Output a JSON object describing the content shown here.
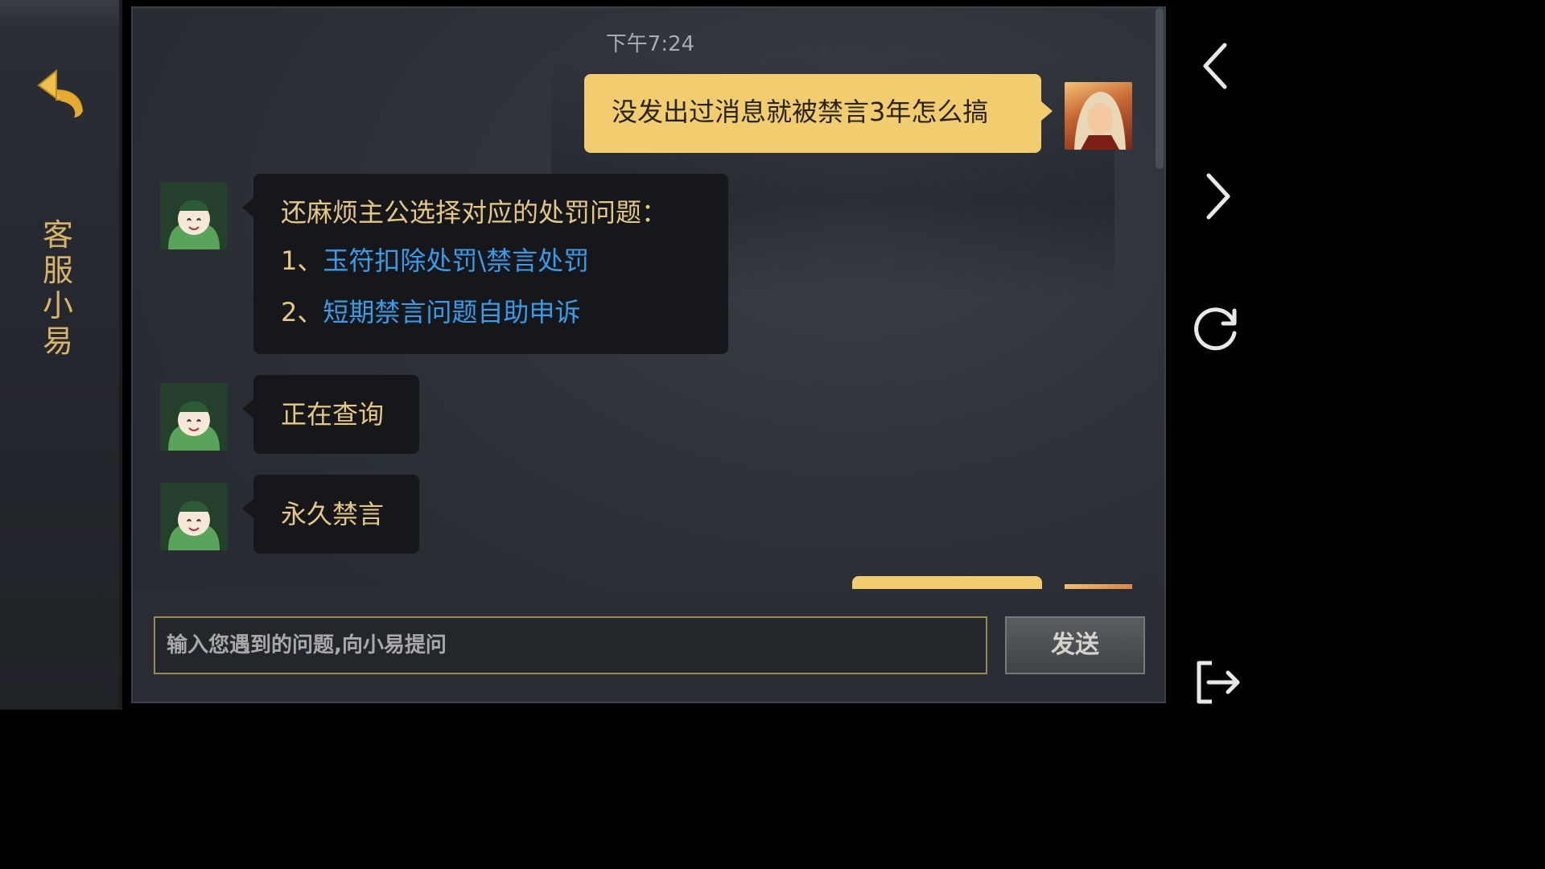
{
  "sidebar": {
    "title": "客服小易",
    "back_icon": "back-arrow-icon"
  },
  "chat": {
    "timestamp": "下午7:24",
    "messages": [
      {
        "from": "user",
        "text": "没发出过消息就被禁言3年怎么搞"
      },
      {
        "from": "bot",
        "intro": "还麻烦主公选择对应的处罚问题：",
        "options": [
          {
            "prefix": "1、",
            "label": "玉符扣除处罚\\禁言处罚"
          },
          {
            "prefix": "2、",
            "label": "短期禁言问题自助申诉"
          }
        ]
      },
      {
        "from": "bot",
        "text": "正在查询"
      },
      {
        "from": "bot",
        "text": "永久禁言"
      }
    ]
  },
  "input": {
    "placeholder": "输入您遇到的问题,向小易提问",
    "value": "",
    "send_label": "发送"
  },
  "nav": {
    "icons": [
      "back-icon",
      "forward-icon",
      "refresh-icon",
      "exit-icon"
    ]
  },
  "colors": {
    "user_bubble": "#f1cd70",
    "bot_bubble": "#15171b",
    "bot_text": "#e7c882",
    "link": "#3a9ce8",
    "title": "#d9b36a"
  }
}
